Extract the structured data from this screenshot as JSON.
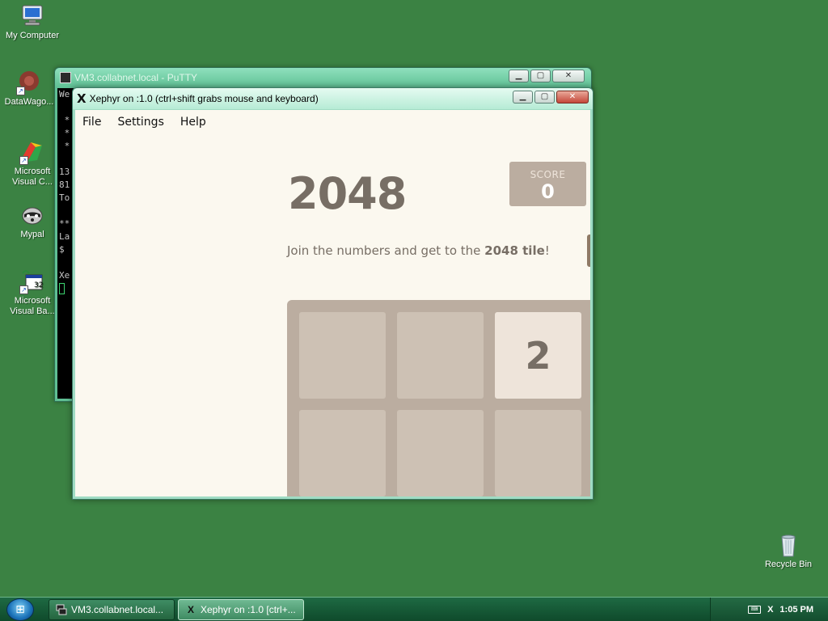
{
  "desktop": {
    "icons": [
      {
        "label": "My Computer"
      },
      {
        "label": "DataWago..."
      },
      {
        "label": "Microsoft Visual C..."
      },
      {
        "label": "Mypal"
      },
      {
        "label": "Microsoft Visual Ba..."
      },
      {
        "label": "Recycle Bin"
      }
    ]
  },
  "putty": {
    "title": "VM3.collabnet.local - PuTTY",
    "terminal_lines": [
      "We",
      "",
      " *",
      " *",
      " *",
      "",
      "13",
      "81",
      "To",
      "",
      "**",
      "La",
      "$",
      "",
      "Xe"
    ]
  },
  "xephyr": {
    "title": "Xephyr on :1.0 (ctrl+shift grabs mouse and keyboard)",
    "menu": [
      "File",
      "Settings",
      "Help"
    ]
  },
  "game": {
    "title": "2048",
    "score_label": "SCORE",
    "score_value": "0",
    "intro_prefix": "Join the numbers and get to the ",
    "intro_bold": "2048 tile",
    "intro_suffix": "!",
    "visible_cells": [
      "",
      "",
      "2",
      "",
      "",
      ""
    ]
  },
  "taskbar": {
    "items": [
      {
        "label": "VM3.collabnet.local..."
      },
      {
        "label": "Xephyr on :1.0 [ctrl+..."
      }
    ],
    "clock": "1:05 PM"
  },
  "colors": {
    "desktop_bg": "#3b8243",
    "board_bg": "#bbada0",
    "empty_cell": "#cdc1b4",
    "tile_2": "#eee4da",
    "game_text": "#776e65"
  }
}
